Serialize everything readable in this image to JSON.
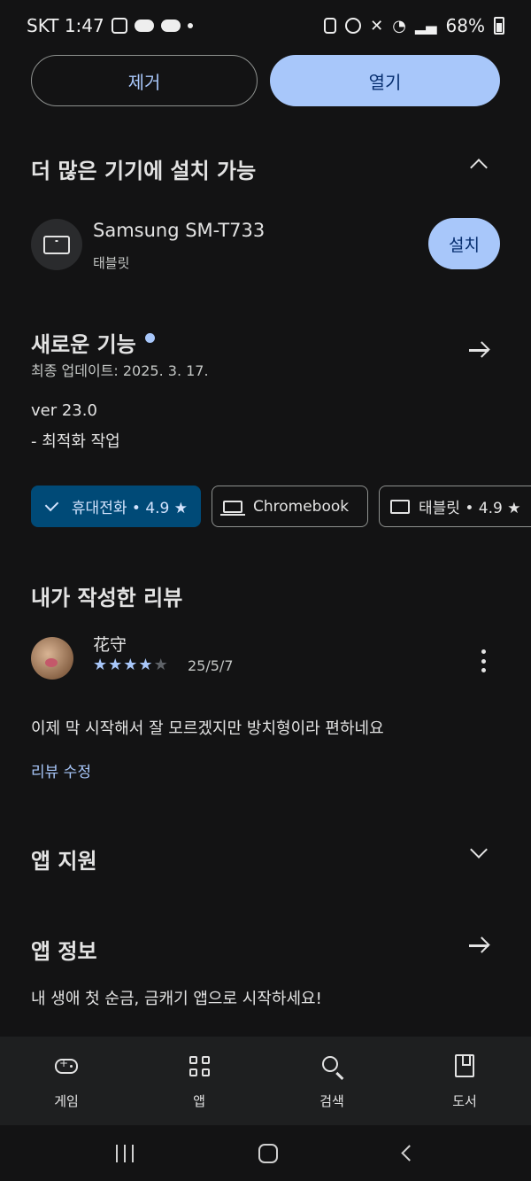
{
  "status_bar": {
    "carrier_time": "SKT 1:47",
    "battery": "68%"
  },
  "actions": {
    "uninstall_label": "제거",
    "open_label": "열기"
  },
  "devices_section": {
    "title": "더 많은 기기에 설치 가능",
    "device_name": "Samsung SM-T733",
    "device_type": "태블릿",
    "install_label": "설치"
  },
  "whats_new": {
    "title": "새로운 기능",
    "updated": "최종 업데이트: 2025. 3. 17.",
    "version": "ver 23.0",
    "notes": "- 최적화 작업"
  },
  "device_chips": [
    {
      "label": "휴대전화 • 4.9 ★",
      "selected": true
    },
    {
      "label": "Chromebook",
      "selected": false
    },
    {
      "label": "태블릿 • 4.9 ★",
      "selected": false
    }
  ],
  "my_review": {
    "title": "내가 작성한 리뷰",
    "reviewer": "花守",
    "rating": 4,
    "max_rating": 5,
    "date": "25/5/7",
    "text": "이제 막 시작해서 잘 모르겠지만 방치형이라 편하네요",
    "edit_label": "리뷰 수정"
  },
  "app_support": {
    "title": "앱 지원"
  },
  "app_info": {
    "title": "앱 정보",
    "tagline": "내 생애 첫 순금, 금캐기 앱으로 시작하세요!"
  },
  "bottom_nav": [
    {
      "label": "게임",
      "icon": "gamepad-icon"
    },
    {
      "label": "앱",
      "icon": "apps-grid-icon"
    },
    {
      "label": "검색",
      "icon": "search-icon"
    },
    {
      "label": "도서",
      "icon": "book-icon"
    }
  ],
  "colors": {
    "accent": "#a8c7fa",
    "background": "#131314",
    "chip_selected": "#004a77"
  }
}
